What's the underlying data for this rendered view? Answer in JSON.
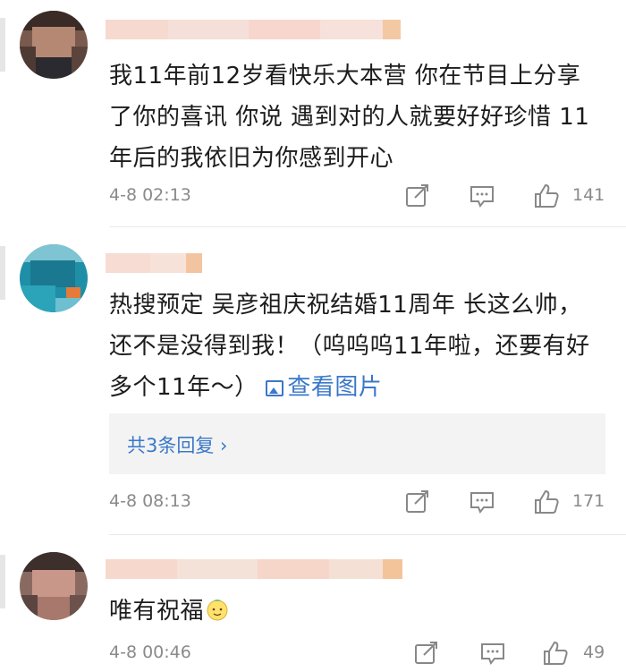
{
  "comments": [
    {
      "text": "我11年前12岁看快乐大本营 你在节目上分享了你的喜讯 你说 遇到对的人就要好好珍惜 11年后的我依旧为你感到开心",
      "time": "4-8 02:13",
      "likes": "141"
    },
    {
      "text": "热搜预定 吴彦祖庆祝结婚11周年  长这么帅，还不是没得到我！（呜呜呜11年啦，还要有好多个11年～）",
      "view_image": "查看图片",
      "replies": "共3条回复 ›",
      "time": "4-8 08:13",
      "likes": "171"
    },
    {
      "text": "唯有祝福",
      "time": "4-8 00:46",
      "likes": "49"
    }
  ],
  "colors": {
    "link": "#3a78c9",
    "meta": "#8a8a8a",
    "reply_bg": "#f3f3f3"
  },
  "icons": [
    "share-icon",
    "comment-icon",
    "like-icon",
    "emoji-icon"
  ]
}
